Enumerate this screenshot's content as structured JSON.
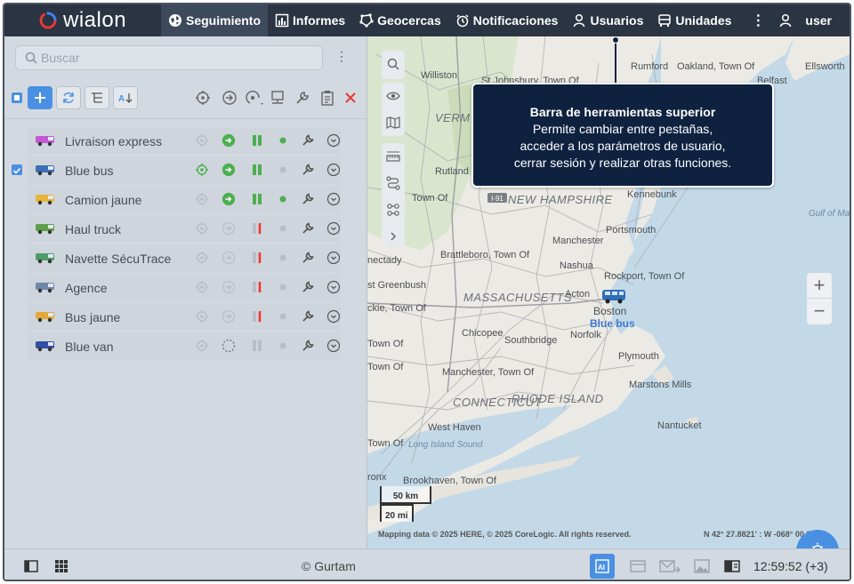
{
  "brand": {
    "logo_text": "wialon"
  },
  "nav": {
    "items": [
      {
        "label": "Seguimiento",
        "icon": "globe-icon",
        "active": true
      },
      {
        "label": "Informes",
        "icon": "chart-icon",
        "active": false
      },
      {
        "label": "Geocercas",
        "icon": "geofence-icon",
        "active": false
      },
      {
        "label": "Notificaciones",
        "icon": "alarm-clock-icon",
        "active": false
      },
      {
        "label": "Usuarios",
        "icon": "user-icon",
        "active": false
      },
      {
        "label": "Unidades",
        "icon": "bus-icon",
        "active": false
      }
    ],
    "user_label": "user"
  },
  "left_panel": {
    "search_placeholder": "Buscar",
    "units": [
      {
        "name": "Livraison express",
        "checked": false,
        "vehicle_color": "#c05ad0",
        "status_dot": "#4caf50",
        "motion": "active"
      },
      {
        "name": "Blue bus",
        "checked": true,
        "vehicle_color": "#3a6fb5",
        "status_dot": "#b9bec5",
        "motion": "active"
      },
      {
        "name": "Camion jaune",
        "checked": false,
        "vehicle_color": "#e6b53a",
        "status_dot": "#4caf50",
        "motion": "active"
      },
      {
        "name": "Haul truck",
        "checked": false,
        "vehicle_color": "#5ea04a",
        "status_dot": "#b9bec5",
        "motion": "inactive"
      },
      {
        "name": "Navette SécuTrace",
        "checked": false,
        "vehicle_color": "#4d9a6a",
        "status_dot": "#b9bec5",
        "motion": "inactive"
      },
      {
        "name": "Agence",
        "checked": false,
        "vehicle_color": "#6f86a8",
        "status_dot": "#b9bec5",
        "motion": "inactive"
      },
      {
        "name": "Bus jaune",
        "checked": false,
        "vehicle_color": "#e0a93a",
        "status_dot": "#b9bec5",
        "motion": "inactive"
      },
      {
        "name": "Blue van",
        "checked": false,
        "vehicle_color": "#2f4fa3",
        "status_dot": "#b9bec5",
        "motion": "none"
      }
    ]
  },
  "map": {
    "labels": [
      "Williston",
      "St Johnsbury, Town Of",
      "Rumford",
      "Oakland, Town Of",
      "Ellsworth",
      "Belfast",
      "Rutland",
      "Town Of",
      "Kennebunk",
      "Gulf of Maine",
      "Manchester",
      "Portsmouth",
      "Brattleboro, Town Of",
      "Nashua",
      "Rockport, Town Of",
      "nectady",
      "st Greenbush",
      "Acton",
      "Boston",
      "Blue bus",
      "ckie, Town Of",
      "Chicopee",
      "Norfolk",
      "Southbridge",
      "Town Of",
      "Plymouth",
      "Manchester, Town Of",
      "Marstons Mills",
      "Town Of",
      "Nantucket",
      "West Haven",
      "Town Of",
      "Long Island Sound",
      "ronx",
      "Brookhaven, Town Of"
    ],
    "states": [
      "VERM",
      "NEW HAMPSHIRE",
      "MASSACHUSETTS",
      "CONNECTICUT",
      "RHODE ISLAND"
    ],
    "scale_km": "50 km",
    "scale_mi": "20 mi",
    "attribution": "Mapping data © 2025 HERE, © 2025 CoreLogic. All rights reserved.",
    "coordinates": "N 42° 27.8821' : W -068° 00.2232'",
    "route_badge": "I-91"
  },
  "tooltip": {
    "title": "Barra de herramientas superior",
    "line1": "Permite cambiar entre pestañas,",
    "line2": "acceder a los parámetros de usuario,",
    "line3": "cerrar sesión y realizar otras funciones."
  },
  "footer": {
    "copyright": "© Gurtam",
    "clock": "12:59:52 (+3)"
  },
  "colors": {
    "topbar": "#2a3442",
    "accent": "#4a90e2",
    "tooltip_bg": "#0e2240",
    "highlight": "#6fd6e8"
  }
}
